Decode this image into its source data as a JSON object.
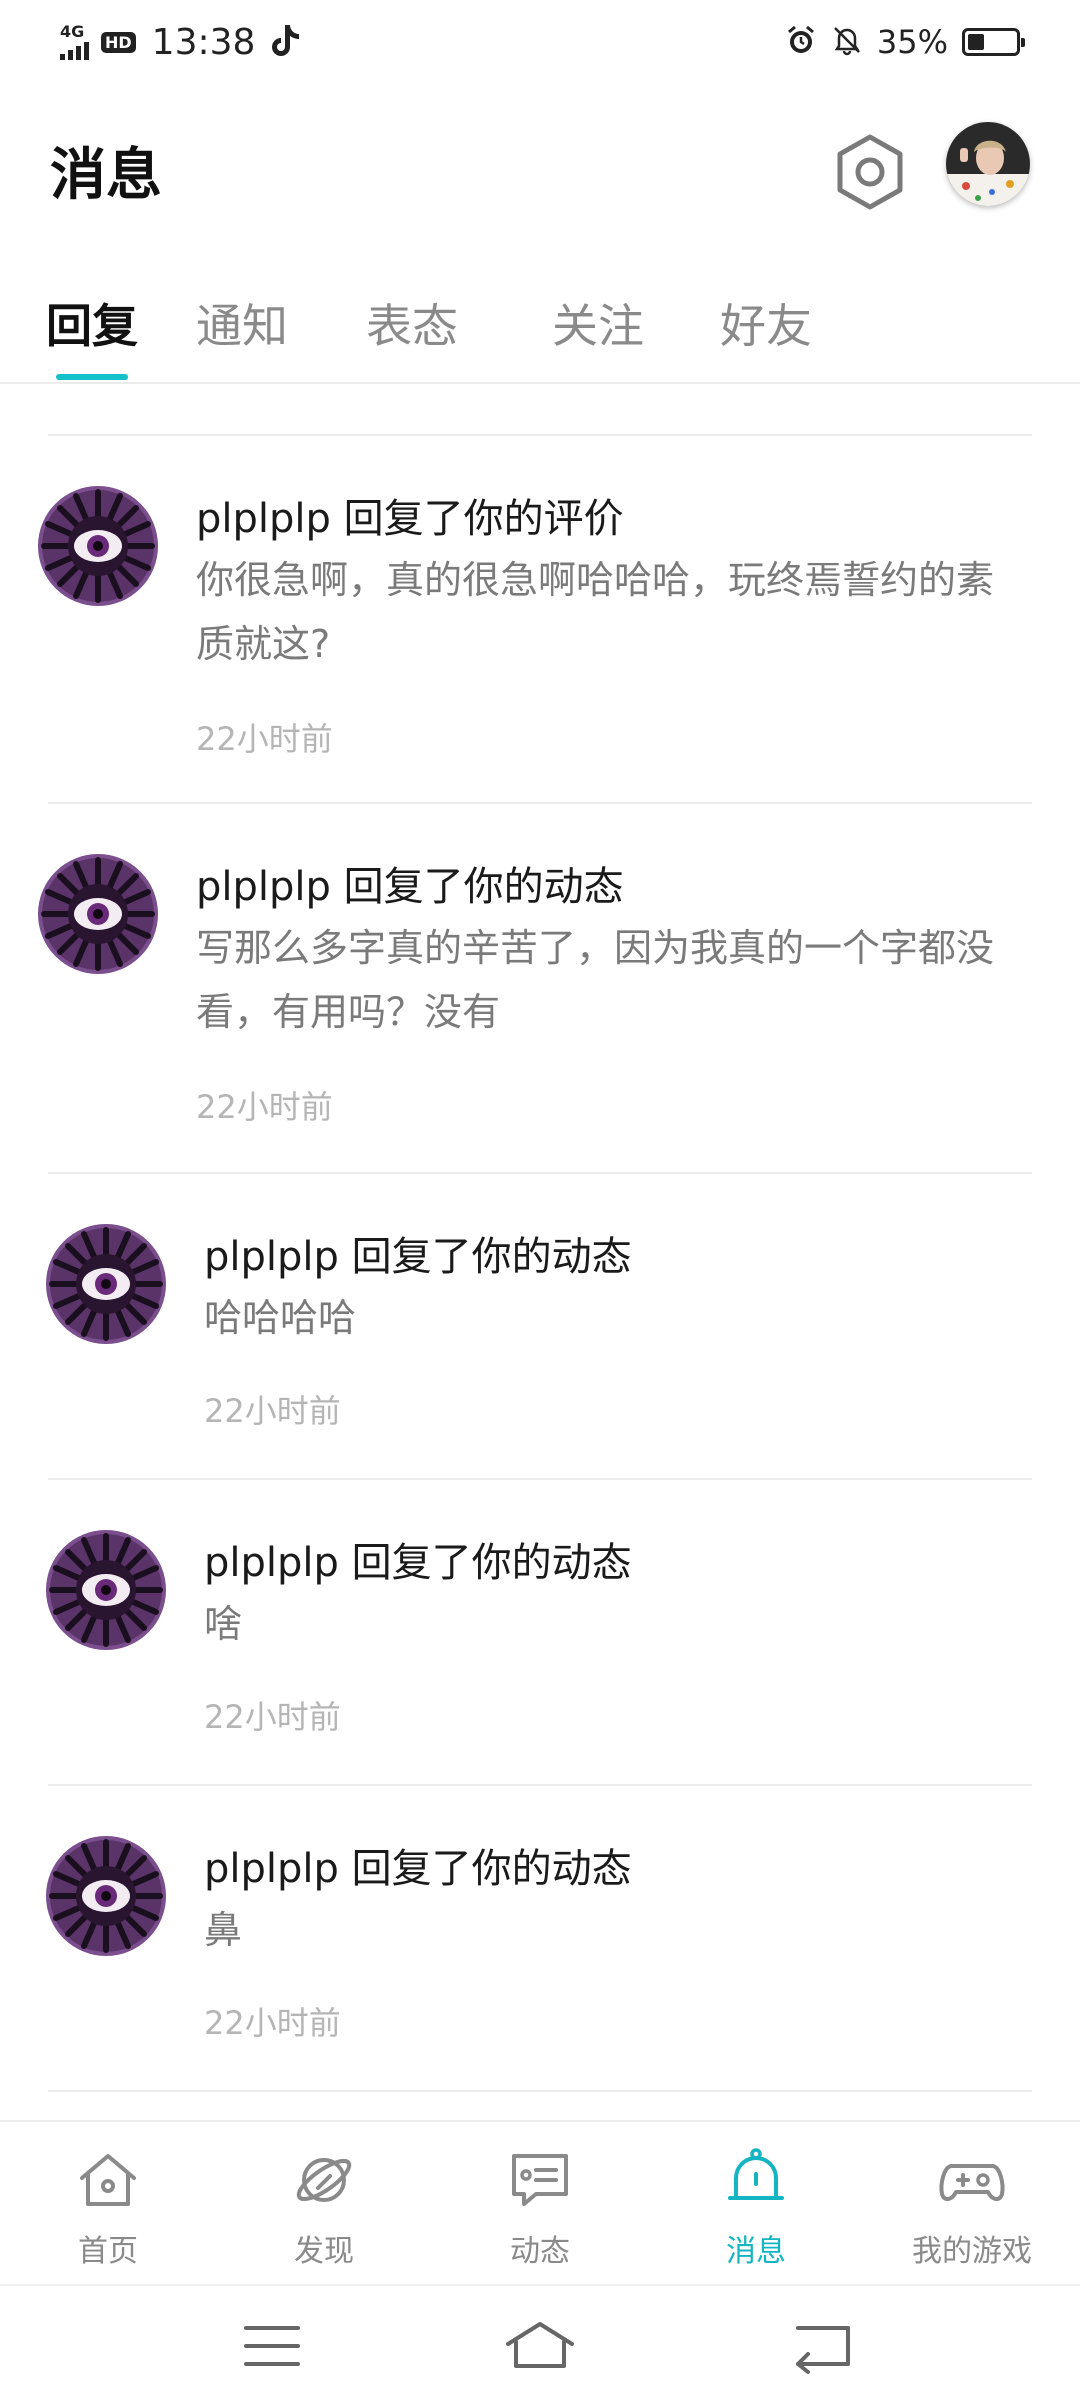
{
  "status_bar": {
    "network": "4G",
    "hd": "HD",
    "time": "13:38",
    "battery_text": "35%",
    "battery_level": 0.35
  },
  "header": {
    "title": "消息"
  },
  "tabs": [
    {
      "label": "回复",
      "active": true
    },
    {
      "label": "通知",
      "active": false
    },
    {
      "label": "表态",
      "active": false
    },
    {
      "label": "关注",
      "active": false
    },
    {
      "label": "好友",
      "active": false
    }
  ],
  "messages": [
    {
      "title": "plplplp 回复了你的评价",
      "body": "你很急啊，真的很急啊哈哈哈，玩终焉誓约的素质就这?",
      "time": "22小时前"
    },
    {
      "title": "plplplp 回复了你的动态",
      "body": "写那么多字真的辛苦了，因为我真的一个字都没看，有用吗？没有",
      "time": "22小时前"
    },
    {
      "title": "plplplp 回复了你的动态",
      "body": "哈哈哈哈",
      "time": "22小时前"
    },
    {
      "title": "plplplp 回复了你的动态",
      "body": "啥",
      "time": "22小时前"
    },
    {
      "title": "plplplp 回复了你的动态",
      "body": "鼻",
      "time": "22小时前"
    }
  ],
  "bottom_nav": [
    {
      "label": "首页",
      "icon": "home-icon",
      "active": false
    },
    {
      "label": "发现",
      "icon": "planet-icon",
      "active": false
    },
    {
      "label": "动态",
      "icon": "feed-icon",
      "active": false
    },
    {
      "label": "消息",
      "icon": "bell-icon",
      "active": true
    },
    {
      "label": "我的游戏",
      "icon": "gamepad-icon",
      "active": false
    }
  ],
  "colors": {
    "accent": "#14c0cc",
    "text_primary": "#1a1a1a",
    "text_secondary": "#7a7a7a",
    "text_muted": "#b5b5b5",
    "avatar_purple": "#7b4f8e"
  }
}
